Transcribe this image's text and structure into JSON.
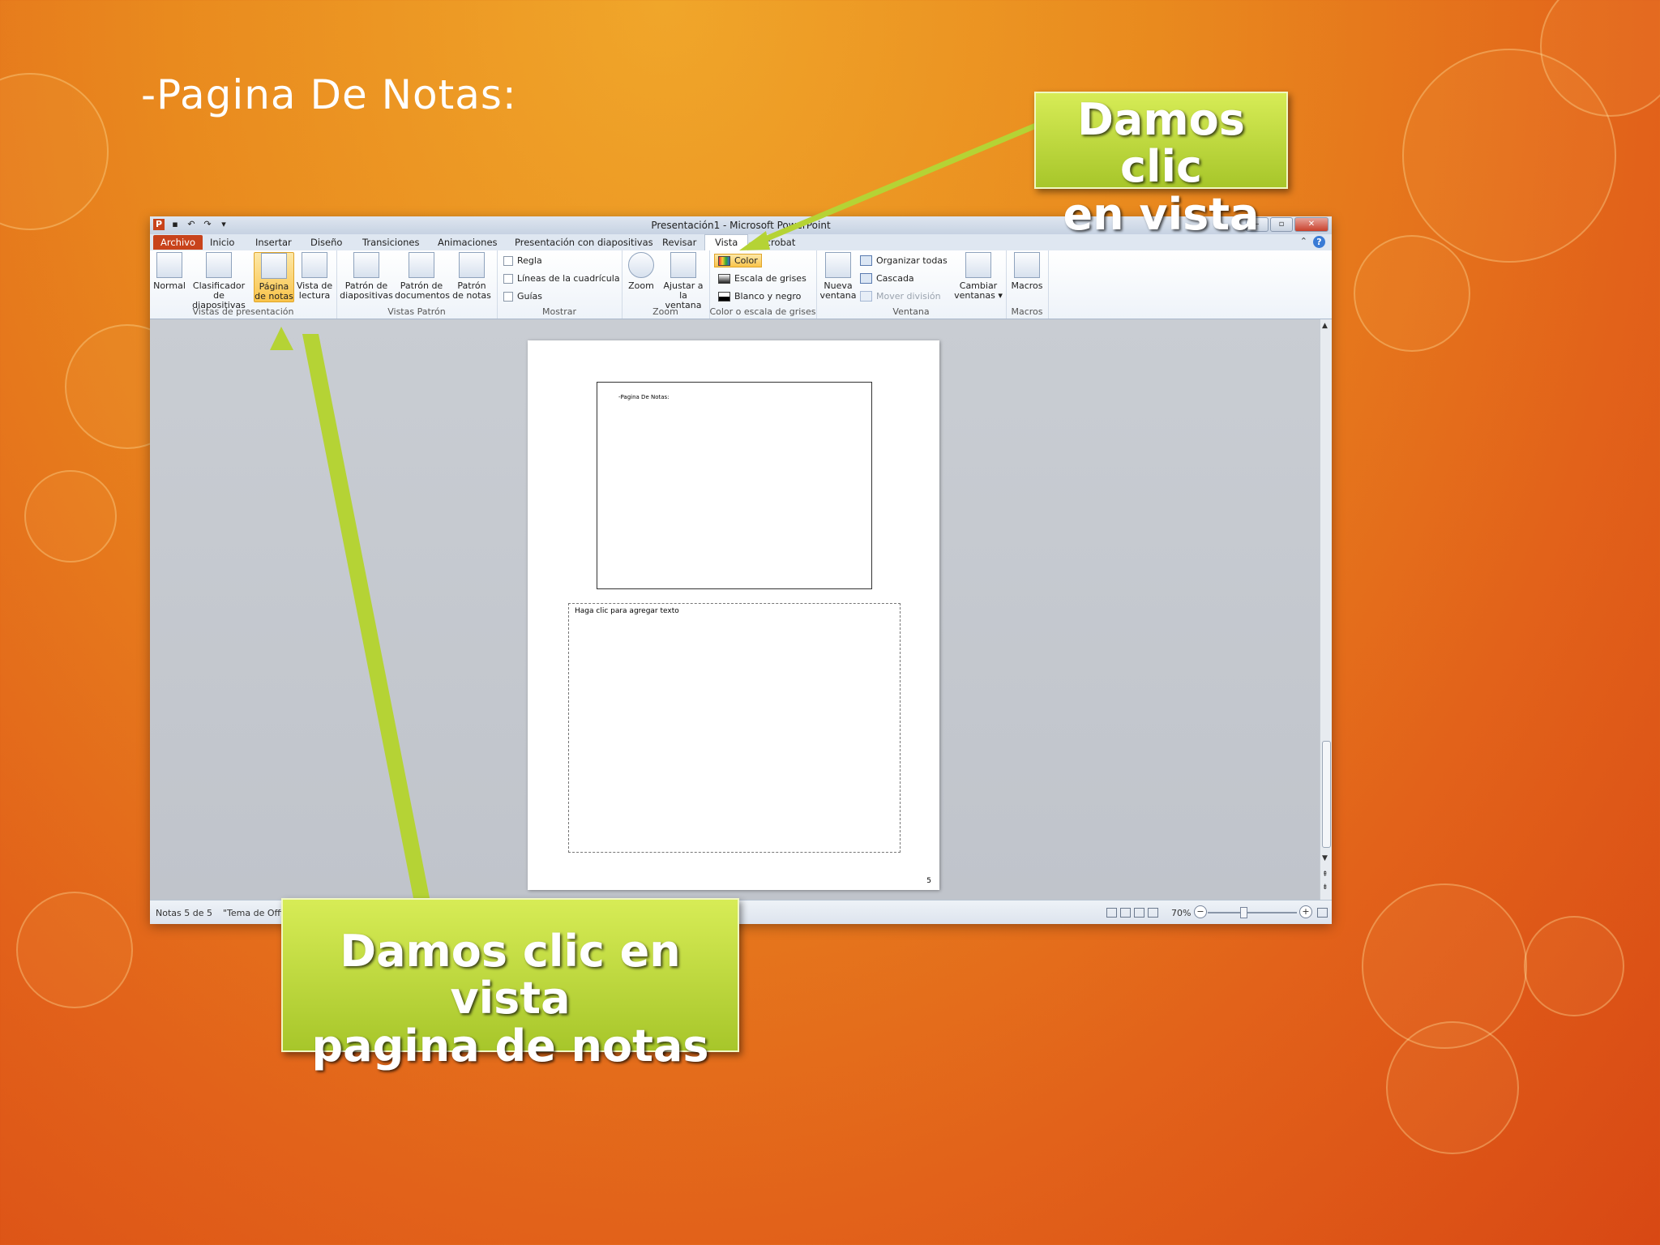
{
  "slide": {
    "title": "-Pagina De Notas:"
  },
  "window": {
    "title": "Presentación1 - Microsoft PowerPoint",
    "buttons": {
      "minimize": "–",
      "restore": "▫",
      "close": "✕"
    }
  },
  "tabs": [
    "Archivo",
    "Inicio",
    "Insertar",
    "Diseño",
    "Transiciones",
    "Animaciones",
    "Presentación con diapositivas",
    "Revisar",
    "Vista",
    "Acrobat"
  ],
  "ribbon": {
    "groups": {
      "vistas_presentacion": "Vistas de presentación",
      "vistas_patron": "Vistas Patrón",
      "mostrar": "Mostrar",
      "zoom": "Zoom",
      "color": "Color o escala de grises",
      "ventana": "Ventana",
      "macros": "Macros"
    },
    "buttons": {
      "normal": "Normal",
      "clasificador_1": "Clasificador de",
      "clasificador_2": "diapositivas",
      "pagina_1": "Página",
      "pagina_2": "de notas",
      "lectura_1": "Vista de",
      "lectura_2": "lectura",
      "patron_diap_1": "Patrón de",
      "patron_diap_2": "diapositivas",
      "patron_doc_1": "Patrón de",
      "patron_doc_2": "documentos",
      "patron_notas_1": "Patrón",
      "patron_notas_2": "de notas",
      "regla": "Regla",
      "lineas": "Líneas de la cuadrícula",
      "guias": "Guías",
      "zoom": "Zoom",
      "ajustar_1": "Ajustar a",
      "ajustar_2": "la ventana",
      "color": "Color",
      "escala": "Escala de grises",
      "blanco": "Blanco y negro",
      "nueva_1": "Nueva",
      "nueva_2": "ventana",
      "organizar": "Organizar todas",
      "cascada": "Cascada",
      "mover": "Mover división",
      "cambiar_1": "Cambiar",
      "cambiar_2": "ventanas ▾",
      "macros": "Macros"
    }
  },
  "page": {
    "slide_thumb_text": "-Pagina De Notas:",
    "notes_placeholder": "Haga clic para agregar texto",
    "page_number": "5"
  },
  "status": {
    "notes": "Notas 5 de 5",
    "theme": "\"Tema de Offi",
    "zoom": "70%"
  },
  "callouts": {
    "top_1": "Damos clic",
    "top_2": "en vista",
    "bottom_1": "Damos clic en vista",
    "bottom_2": "pagina de notas"
  },
  "colors": {
    "callout": "#b5d335",
    "file_tab": "#c8431b",
    "selected_button": "#f9c44b"
  }
}
